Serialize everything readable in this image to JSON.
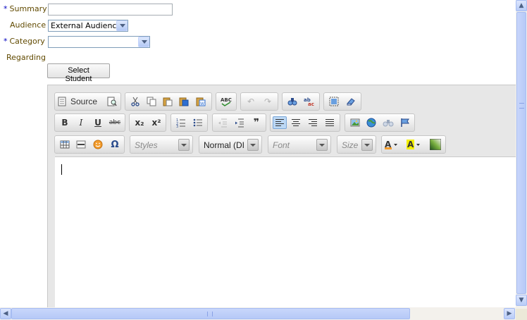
{
  "form": {
    "summary": {
      "label": "Summary",
      "required_mark": "*",
      "value": ""
    },
    "audience": {
      "label": "Audience",
      "selected": "External Audience"
    },
    "category": {
      "label": "Category",
      "required_mark": "*",
      "selected": ""
    },
    "regarding": {
      "label": "Regarding",
      "button_label": "Select Student"
    }
  },
  "editor": {
    "toolbar_row1": {
      "source_label": "Source",
      "icons": [
        "preview-icon",
        "cut-icon",
        "copy-icon",
        "paste-icon",
        "paste-text-icon",
        "paste-word-icon",
        "spellcheck-icon",
        "undo-icon",
        "redo-icon",
        "find-icon",
        "replace-icon",
        "select-all-icon",
        "remove-format-icon"
      ]
    },
    "toolbar_row2": {
      "bold": "B",
      "italic": "I",
      "underline": "U",
      "strike": "abc",
      "subscript": "x₂",
      "superscript": "x²"
    },
    "toolbar_row3": {
      "styles_placeholder": "Styles",
      "format_value": "Normal (DI",
      "font_placeholder": "Font",
      "size_placeholder": "Size"
    },
    "content_text": ""
  },
  "colors": {
    "label": "#614a00",
    "required": "#0000c0",
    "toolbar_bg": "#e7e7e7",
    "active_button": "#bcd8f5",
    "scrollbar": "#b6c9f7"
  }
}
